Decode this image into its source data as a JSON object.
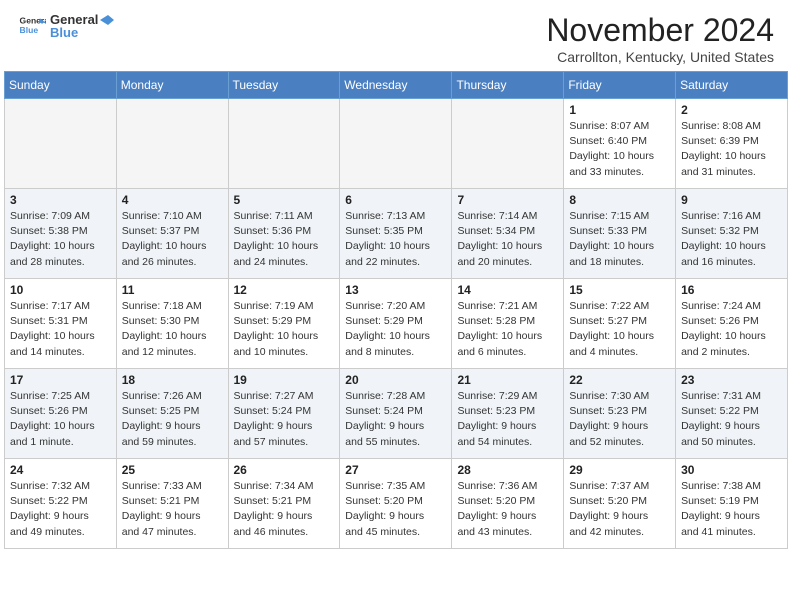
{
  "header": {
    "logo_line1": "General",
    "logo_line2": "Blue",
    "month": "November 2024",
    "location": "Carrollton, Kentucky, United States"
  },
  "weekdays": [
    "Sunday",
    "Monday",
    "Tuesday",
    "Wednesday",
    "Thursday",
    "Friday",
    "Saturday"
  ],
  "weeks": [
    [
      {
        "day": "",
        "info": ""
      },
      {
        "day": "",
        "info": ""
      },
      {
        "day": "",
        "info": ""
      },
      {
        "day": "",
        "info": ""
      },
      {
        "day": "",
        "info": ""
      },
      {
        "day": "1",
        "info": "Sunrise: 8:07 AM\nSunset: 6:40 PM\nDaylight: 10 hours\nand 33 minutes."
      },
      {
        "day": "2",
        "info": "Sunrise: 8:08 AM\nSunset: 6:39 PM\nDaylight: 10 hours\nand 31 minutes."
      }
    ],
    [
      {
        "day": "3",
        "info": "Sunrise: 7:09 AM\nSunset: 5:38 PM\nDaylight: 10 hours\nand 28 minutes."
      },
      {
        "day": "4",
        "info": "Sunrise: 7:10 AM\nSunset: 5:37 PM\nDaylight: 10 hours\nand 26 minutes."
      },
      {
        "day": "5",
        "info": "Sunrise: 7:11 AM\nSunset: 5:36 PM\nDaylight: 10 hours\nand 24 minutes."
      },
      {
        "day": "6",
        "info": "Sunrise: 7:13 AM\nSunset: 5:35 PM\nDaylight: 10 hours\nand 22 minutes."
      },
      {
        "day": "7",
        "info": "Sunrise: 7:14 AM\nSunset: 5:34 PM\nDaylight: 10 hours\nand 20 minutes."
      },
      {
        "day": "8",
        "info": "Sunrise: 7:15 AM\nSunset: 5:33 PM\nDaylight: 10 hours\nand 18 minutes."
      },
      {
        "day": "9",
        "info": "Sunrise: 7:16 AM\nSunset: 5:32 PM\nDaylight: 10 hours\nand 16 minutes."
      }
    ],
    [
      {
        "day": "10",
        "info": "Sunrise: 7:17 AM\nSunset: 5:31 PM\nDaylight: 10 hours\nand 14 minutes."
      },
      {
        "day": "11",
        "info": "Sunrise: 7:18 AM\nSunset: 5:30 PM\nDaylight: 10 hours\nand 12 minutes."
      },
      {
        "day": "12",
        "info": "Sunrise: 7:19 AM\nSunset: 5:29 PM\nDaylight: 10 hours\nand 10 minutes."
      },
      {
        "day": "13",
        "info": "Sunrise: 7:20 AM\nSunset: 5:29 PM\nDaylight: 10 hours\nand 8 minutes."
      },
      {
        "day": "14",
        "info": "Sunrise: 7:21 AM\nSunset: 5:28 PM\nDaylight: 10 hours\nand 6 minutes."
      },
      {
        "day": "15",
        "info": "Sunrise: 7:22 AM\nSunset: 5:27 PM\nDaylight: 10 hours\nand 4 minutes."
      },
      {
        "day": "16",
        "info": "Sunrise: 7:24 AM\nSunset: 5:26 PM\nDaylight: 10 hours\nand 2 minutes."
      }
    ],
    [
      {
        "day": "17",
        "info": "Sunrise: 7:25 AM\nSunset: 5:26 PM\nDaylight: 10 hours\nand 1 minute."
      },
      {
        "day": "18",
        "info": "Sunrise: 7:26 AM\nSunset: 5:25 PM\nDaylight: 9 hours\nand 59 minutes."
      },
      {
        "day": "19",
        "info": "Sunrise: 7:27 AM\nSunset: 5:24 PM\nDaylight: 9 hours\nand 57 minutes."
      },
      {
        "day": "20",
        "info": "Sunrise: 7:28 AM\nSunset: 5:24 PM\nDaylight: 9 hours\nand 55 minutes."
      },
      {
        "day": "21",
        "info": "Sunrise: 7:29 AM\nSunset: 5:23 PM\nDaylight: 9 hours\nand 54 minutes."
      },
      {
        "day": "22",
        "info": "Sunrise: 7:30 AM\nSunset: 5:23 PM\nDaylight: 9 hours\nand 52 minutes."
      },
      {
        "day": "23",
        "info": "Sunrise: 7:31 AM\nSunset: 5:22 PM\nDaylight: 9 hours\nand 50 minutes."
      }
    ],
    [
      {
        "day": "24",
        "info": "Sunrise: 7:32 AM\nSunset: 5:22 PM\nDaylight: 9 hours\nand 49 minutes."
      },
      {
        "day": "25",
        "info": "Sunrise: 7:33 AM\nSunset: 5:21 PM\nDaylight: 9 hours\nand 47 minutes."
      },
      {
        "day": "26",
        "info": "Sunrise: 7:34 AM\nSunset: 5:21 PM\nDaylight: 9 hours\nand 46 minutes."
      },
      {
        "day": "27",
        "info": "Sunrise: 7:35 AM\nSunset: 5:20 PM\nDaylight: 9 hours\nand 45 minutes."
      },
      {
        "day": "28",
        "info": "Sunrise: 7:36 AM\nSunset: 5:20 PM\nDaylight: 9 hours\nand 43 minutes."
      },
      {
        "day": "29",
        "info": "Sunrise: 7:37 AM\nSunset: 5:20 PM\nDaylight: 9 hours\nand 42 minutes."
      },
      {
        "day": "30",
        "info": "Sunrise: 7:38 AM\nSunset: 5:19 PM\nDaylight: 9 hours\nand 41 minutes."
      }
    ]
  ]
}
